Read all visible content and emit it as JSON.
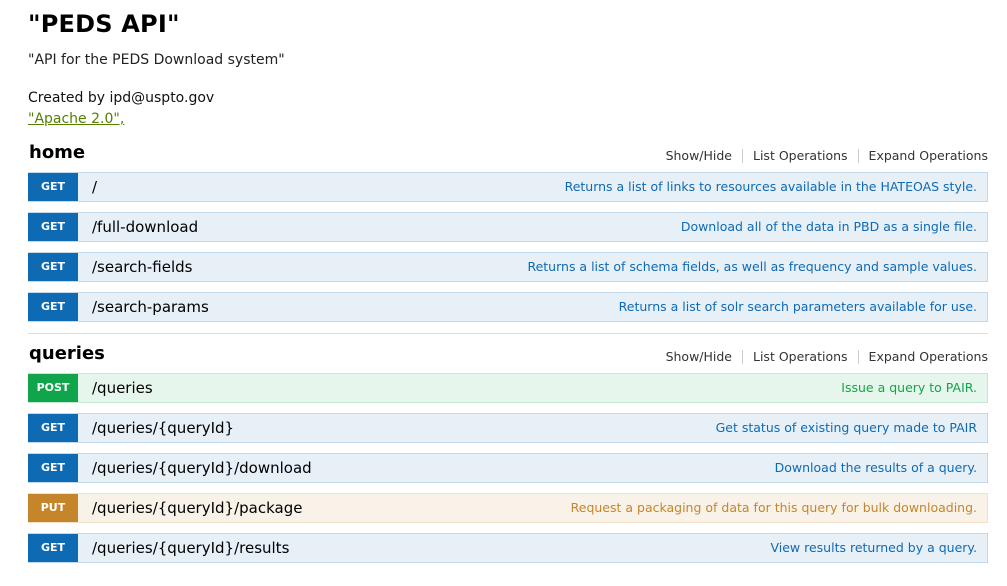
{
  "api": {
    "title": "\"PEDS API\"",
    "description": "\"API for the PEDS Download system\"",
    "contact": "Created by ipd@uspto.gov",
    "license": "\"Apache 2.0\","
  },
  "resources": [
    {
      "name": "home",
      "actions": [
        "Show/Hide",
        "List Operations",
        "Expand Operations"
      ],
      "operations": [
        {
          "method": "GET",
          "path": "/",
          "summary": "Returns a list of links to resources available in the HATEOAS style."
        },
        {
          "method": "GET",
          "path": "/full-download",
          "summary": "Download all of the data in PBD as a single file."
        },
        {
          "method": "GET",
          "path": "/search-fields",
          "summary": "Returns a list of schema fields, as well as frequency and sample values."
        },
        {
          "method": "GET",
          "path": "/search-params",
          "summary": "Returns a list of solr search parameters available for use."
        }
      ]
    },
    {
      "name": "queries",
      "actions": [
        "Show/Hide",
        "List Operations",
        "Expand Operations"
      ],
      "operations": [
        {
          "method": "POST",
          "path": "/queries",
          "summary": "Issue a query to PAIR."
        },
        {
          "method": "GET",
          "path": "/queries/{queryId}",
          "summary": "Get status of existing query made to PAIR"
        },
        {
          "method": "GET",
          "path": "/queries/{queryId}/download",
          "summary": "Download the results of a query."
        },
        {
          "method": "PUT",
          "path": "/queries/{queryId}/package",
          "summary": "Request a packaging of data for this query for bulk downloading."
        },
        {
          "method": "GET",
          "path": "/queries/{queryId}/results",
          "summary": "View results returned by a query."
        }
      ]
    }
  ],
  "colors": {
    "get": "#0f6ab4",
    "post": "#10a54a",
    "put": "#c5862b",
    "license_link": "#547f00"
  }
}
